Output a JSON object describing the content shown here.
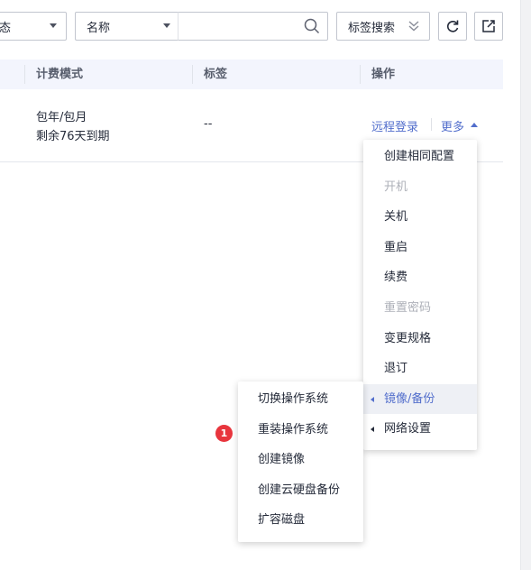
{
  "toolbar": {
    "status_select": "态",
    "field_select": "名称",
    "search_placeholder": "",
    "tag_search_label": "标签搜索"
  },
  "table": {
    "headers": [
      "计费模式",
      "标签",
      "操作"
    ],
    "row": {
      "billing_line1": "包年/包月",
      "billing_line2": "剩余76天到期",
      "tags": "--",
      "remote_login": "远程登录",
      "more": "更多"
    }
  },
  "more_menu": {
    "items": [
      {
        "label": "创建相同配置",
        "disabled": false
      },
      {
        "label": "开机",
        "disabled": true
      },
      {
        "label": "关机",
        "disabled": false
      },
      {
        "label": "重启",
        "disabled": false
      },
      {
        "label": "续费",
        "disabled": false
      },
      {
        "label": "重置密码",
        "disabled": true
      },
      {
        "label": "变更规格",
        "disabled": false
      },
      {
        "label": "退订",
        "disabled": false
      },
      {
        "label": "镜像/备份",
        "disabled": false,
        "submenu": true,
        "active": true
      },
      {
        "label": "网络设置",
        "disabled": false,
        "submenu": true
      }
    ]
  },
  "image_submenu": {
    "items": [
      "切换操作系统",
      "重装操作系统",
      "创建镜像",
      "创建云硬盘备份",
      "扩容磁盘"
    ]
  },
  "badge": {
    "number": "1",
    "color": "#e8353d"
  },
  "colors": {
    "link": "#526ecc",
    "header_bg": "#f3f5fd",
    "disabled": "#adb0b8"
  }
}
